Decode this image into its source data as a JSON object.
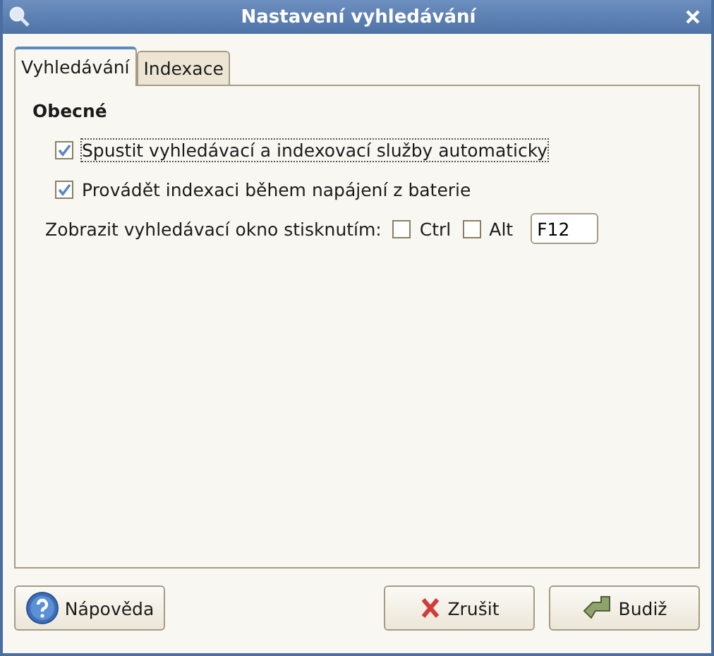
{
  "window": {
    "title": "Nastavení vyhledávání"
  },
  "tabs": [
    {
      "label": "Vyhledávání",
      "selected": true
    },
    {
      "label": "Indexace",
      "selected": false
    }
  ],
  "section": {
    "title": "Obecné"
  },
  "options": [
    {
      "label": "Spustit vyhledávací a indexovací služby automaticky",
      "checked": true,
      "focused": true
    },
    {
      "label": "Provádět indexaci během napájení z baterie",
      "checked": true,
      "focused": false
    }
  ],
  "shortcut": {
    "label": "Zobrazit vyhledávací okno stisknutím:",
    "modifiers": [
      {
        "label": "Ctrl",
        "checked": false
      },
      {
        "label": "Alt",
        "checked": false
      }
    ],
    "key": "F12"
  },
  "buttons": [
    {
      "kind": "help",
      "label": "Nápověda"
    },
    {
      "kind": "cancel",
      "label": "Zrušit"
    },
    {
      "kind": "ok",
      "label": "Budiž"
    }
  ]
}
